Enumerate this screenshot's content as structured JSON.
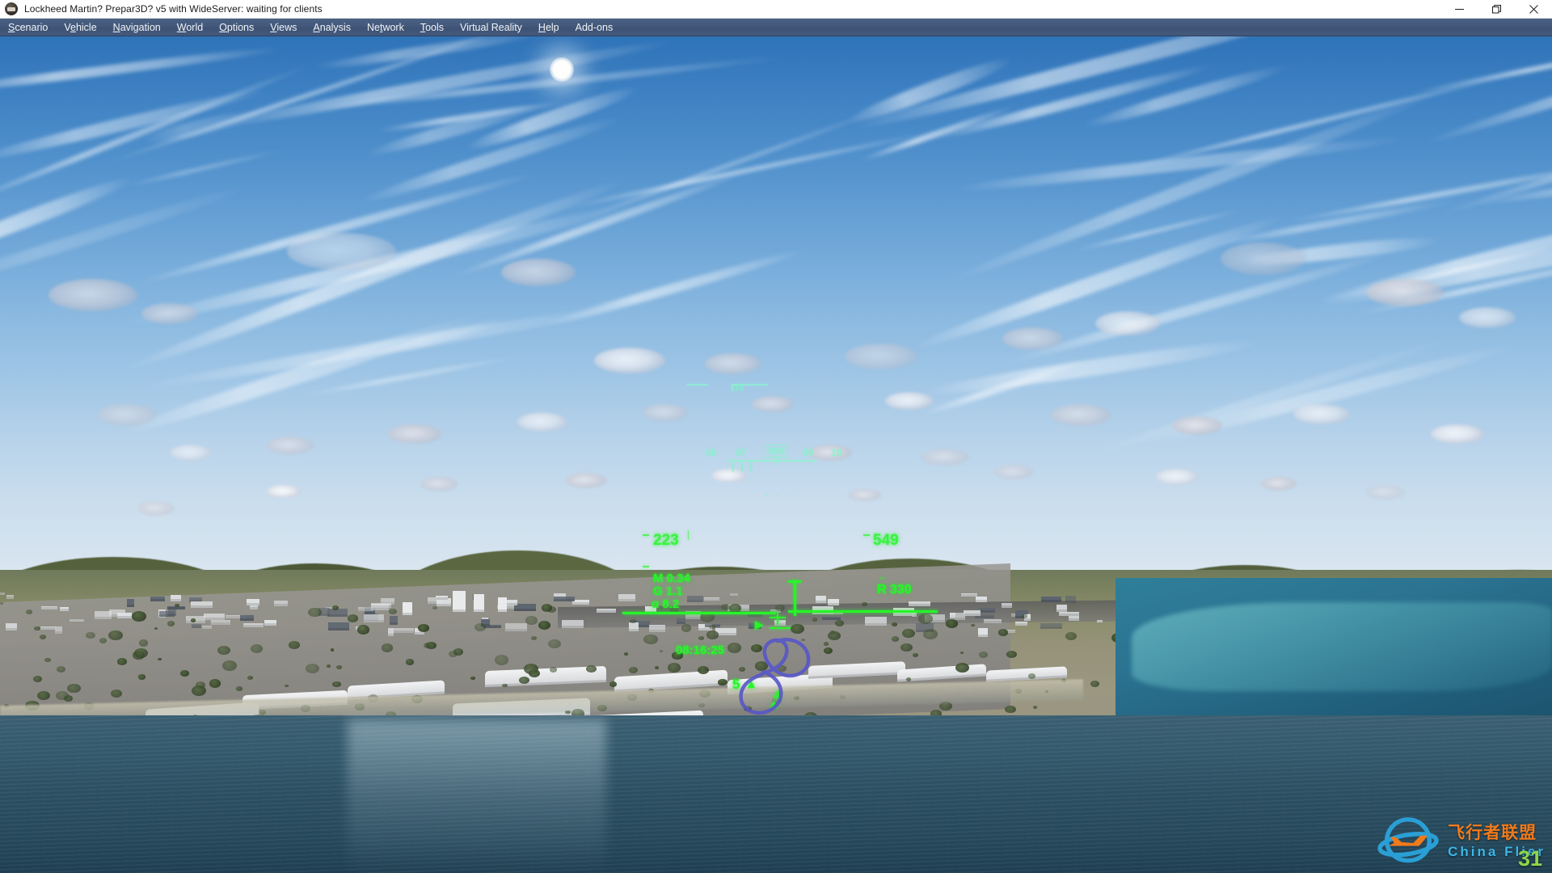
{
  "window": {
    "title": "Lockheed Martin? Prepar3D? v5 with WideServer: waiting for clients",
    "icon": "p3d-app-icon",
    "controls": {
      "minimize": "minimize-icon",
      "restore": "restore-icon",
      "close": "close-icon"
    }
  },
  "menubar": {
    "items": [
      {
        "label": "Scenario",
        "accel": "S"
      },
      {
        "label": "Vehicle",
        "accel": "V"
      },
      {
        "label": "Navigation",
        "accel": "N"
      },
      {
        "label": "World",
        "accel": "W"
      },
      {
        "label": "Options",
        "accel": "O"
      },
      {
        "label": "Views",
        "accel": "V"
      },
      {
        "label": "Analysis",
        "accel": "A"
      },
      {
        "label": "Network",
        "accel": "t"
      },
      {
        "label": "Tools",
        "accel": "T"
      },
      {
        "label": "Virtual Reality",
        "accel": ""
      },
      {
        "label": "Help",
        "accel": "H"
      },
      {
        "label": "Add-ons",
        "accel": ""
      }
    ]
  },
  "hud": {
    "pitch_ladder_label": "15",
    "heading_tape": [
      "06",
      "07",
      "09",
      "10"
    ],
    "heading_boxed": "080",
    "airspeed": "223",
    "altitude": "549",
    "mach": "M 0.34",
    "g_load": "G 1.1",
    "aoa": "α 8.2",
    "radar_alt": "R 330",
    "sim_time": "08:16:25",
    "marker_left": "5",
    "marker_right": "4",
    "color_primary": "#27f528",
    "color_secondary": "#7df7c6"
  },
  "annotation": {
    "name": "blue-freehand-circle",
    "color": "#5656c8"
  },
  "watermark": {
    "chinese": "飞行者联盟",
    "english": "China Flier",
    "number": "31",
    "logo": "plane-orbit-logo",
    "color_cn": "#f07b1d",
    "color_en": "#3bb7e8",
    "color_num": "#8fd64a"
  }
}
